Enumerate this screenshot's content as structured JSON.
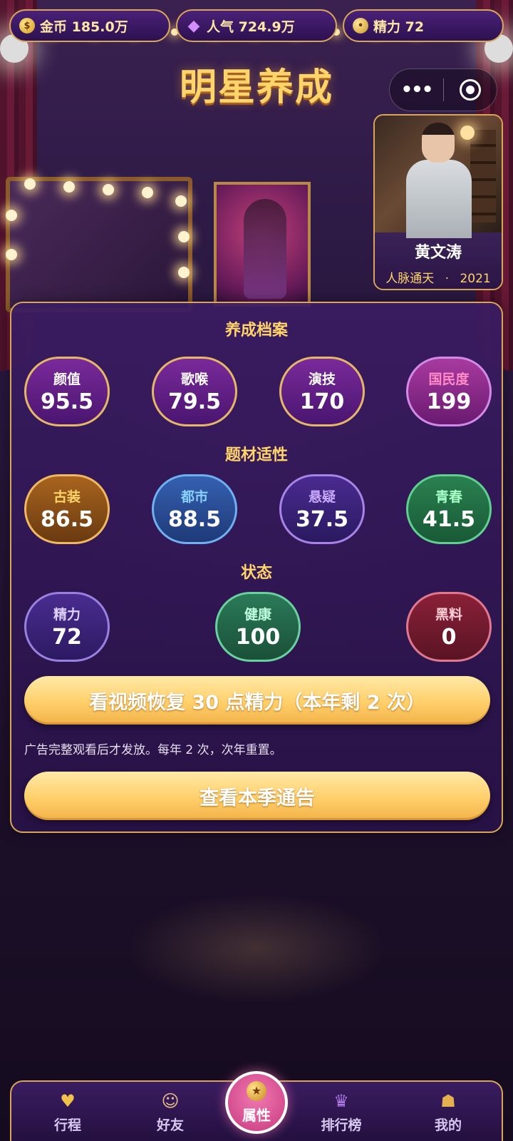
{
  "resources": {
    "coins": {
      "icon": "coin-icon",
      "text": "金币 185.0万"
    },
    "popularity": {
      "icon": "gem-icon",
      "text": "人气 724.9万"
    },
    "energy": {
      "icon": "energy-icon",
      "text": "精力 72"
    }
  },
  "app_title": "明星养成",
  "capsule": {
    "more_glyph": "•••"
  },
  "star": {
    "name": "黄文涛",
    "trait": "人脉通天",
    "separator": "·",
    "year": "2021"
  },
  "profile": {
    "title": "养成档案",
    "stats": [
      {
        "label": "颜值",
        "value": "95.5"
      },
      {
        "label": "歌喉",
        "value": "79.5"
      },
      {
        "label": "演技",
        "value": "170"
      },
      {
        "label": "国民度",
        "value": "199"
      }
    ]
  },
  "genre": {
    "title": "题材适性",
    "stats": [
      {
        "label": "古装",
        "value": "86.5"
      },
      {
        "label": "都市",
        "value": "88.5"
      },
      {
        "label": "悬疑",
        "value": "37.5"
      },
      {
        "label": "青春",
        "value": "41.5"
      }
    ]
  },
  "status": {
    "title": "状态",
    "stats": [
      {
        "label": "精力",
        "value": "72"
      },
      {
        "label": "健康",
        "value": "100"
      },
      {
        "label": "黑料",
        "value": "0"
      }
    ]
  },
  "actions": {
    "watch_video": "看视频恢复 30 点精力（本年剩 2 次）",
    "ad_note": "广告完整观看后才发放。每年 2 次，次年重置。",
    "view_notices": "查看本季通告"
  },
  "nav": {
    "items": [
      {
        "label": "行程",
        "icon": "heart-icon"
      },
      {
        "label": "好友",
        "icon": "friends-icon"
      },
      {
        "label": "属性",
        "icon": "star-medal-icon"
      },
      {
        "label": "排行榜",
        "icon": "trophy-icon"
      },
      {
        "label": "我的",
        "icon": "bag-icon"
      }
    ]
  },
  "colors": {
    "gold": "#ffd46a",
    "panel_border": "#d9a659",
    "active_tab": "#e0559a"
  }
}
